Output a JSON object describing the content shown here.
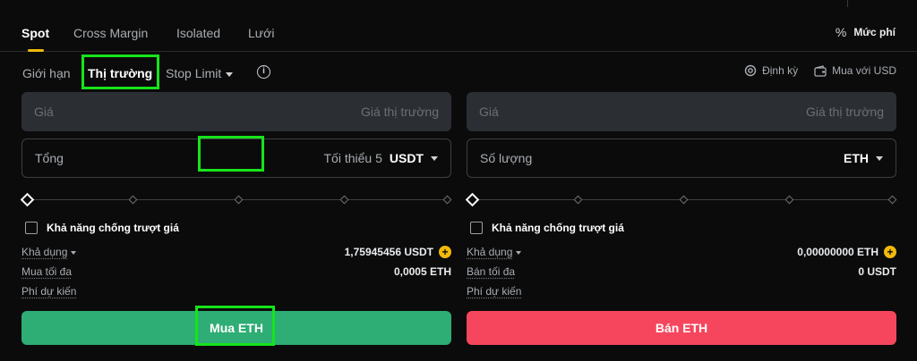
{
  "tabs": [
    {
      "label": "Spot",
      "active": true
    },
    {
      "label": "Cross Margin",
      "active": false
    },
    {
      "label": "Isolated",
      "active": false
    },
    {
      "label": "Lưới",
      "active": false
    }
  ],
  "fee_label": "Mức phí",
  "fee_icon": "percent-icon",
  "order_types": [
    {
      "label": "Giới hạn",
      "active": false
    },
    {
      "label": "Thị trường",
      "active": true
    },
    {
      "label": "Stop Limit",
      "active": false,
      "dropdown": true
    }
  ],
  "info_icon_glyph": "i",
  "links": {
    "recurring": "Định kỳ",
    "recurring_icon": "recurring-icon",
    "buy_with": "Mua với USD",
    "buy_with_icon": "wallet-icon"
  },
  "buy": {
    "price_label": "Giá",
    "price_placeholder": "Giá thị trường",
    "total_label": "Tổng",
    "total_min": "Tối thiểu 5",
    "total_unit": "USDT",
    "slippage_label": "Khả năng chống trượt giá",
    "available_label": "Khả dụng",
    "available_value": "1,75945456 USDT",
    "max_label": "Mua tối đa",
    "max_value": "0,0005 ETH",
    "fee_label": "Phí dự kiến",
    "button": "Mua ETH"
  },
  "sell": {
    "price_label": "Giá",
    "price_placeholder": "Giá thị trường",
    "qty_label": "Số lượng",
    "qty_unit": "ETH",
    "slippage_label": "Khả năng chống trượt giá",
    "available_label": "Khả dụng",
    "available_value": "0,00000000 ETH",
    "max_label": "Bán tối đa",
    "max_value": "0 USDT",
    "fee_label": "Phí dự kiến",
    "button": "Bán ETH"
  },
  "colors": {
    "accent": "#f0b90b",
    "buy": "#2ead74",
    "sell": "#f6465d",
    "highlight": "#16e41a"
  }
}
